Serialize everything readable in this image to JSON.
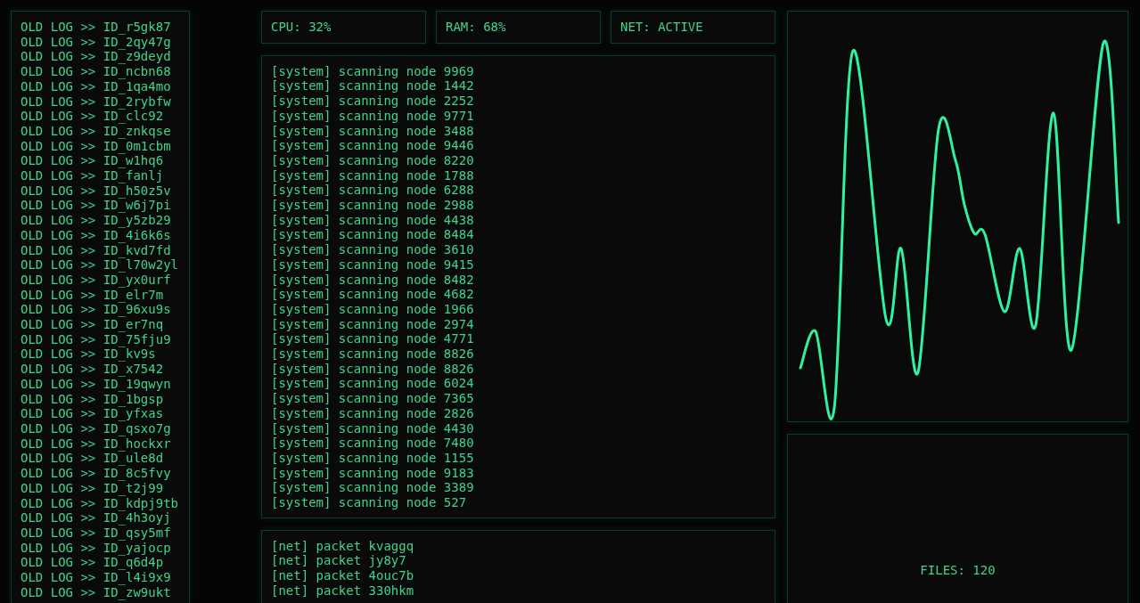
{
  "old_log": {
    "lines": [
      "OLD LOG >> ID_r5gk87",
      "OLD LOG >> ID_2qy47g",
      "OLD LOG >> ID_z9deyd",
      "OLD LOG >> ID_ncbn68",
      "OLD LOG >> ID_1qa4mo",
      "OLD LOG >> ID_2rybfw",
      "OLD LOG >> ID_clc92",
      "OLD LOG >> ID_znkqse",
      "OLD LOG >> ID_0m1cbm",
      "OLD LOG >> ID_w1hq6",
      "OLD LOG >> ID_fanlj",
      "OLD LOG >> ID_h50z5v",
      "OLD LOG >> ID_w6j7pi",
      "OLD LOG >> ID_y5zb29",
      "OLD LOG >> ID_4i6k6s",
      "OLD LOG >> ID_kvd7fd",
      "OLD LOG >> ID_l70w2yl",
      "OLD LOG >> ID_yx0urf",
      "OLD LOG >> ID_elr7m",
      "OLD LOG >> ID_96xu9s",
      "OLD LOG >> ID_er7nq",
      "OLD LOG >> ID_75fju9",
      "OLD LOG >> ID_kv9s",
      "OLD LOG >> ID_x7542",
      "OLD LOG >> ID_19qwyn",
      "OLD LOG >> ID_1bgsp",
      "OLD LOG >> ID_yfxas",
      "OLD LOG >> ID_qsxo7g",
      "OLD LOG >> ID_hockxr",
      "OLD LOG >> ID_ule8d",
      "OLD LOG >> ID_8c5fvy",
      "OLD LOG >> ID_t2j99",
      "OLD LOG >> ID_kdpj9tb",
      "OLD LOG >> ID_4h3oyj",
      "OLD LOG >> ID_qsy5mf",
      "OLD LOG >> ID_yajocp",
      "OLD LOG >> ID_q6d4p",
      "OLD LOG >> ID_l4i9x9",
      "OLD LOG >> ID_zw9ukt"
    ]
  },
  "stats": [
    "CPU: 32%",
    "RAM: 68%",
    "NET: ACTIVE"
  ],
  "system_log": {
    "lines": [
      "[system] scanning node 9969",
      "[system] scanning node 1442",
      "[system] scanning node 2252",
      "[system] scanning node 9771",
      "[system] scanning node 3488",
      "[system] scanning node 9446",
      "[system] scanning node 8220",
      "[system] scanning node 1788",
      "[system] scanning node 6288",
      "[system] scanning node 2988",
      "[system] scanning node 4438",
      "[system] scanning node 8484",
      "[system] scanning node 3610",
      "[system] scanning node 9415",
      "[system] scanning node 8482",
      "[system] scanning node 4682",
      "[system] scanning node 1966",
      "[system] scanning node 2974",
      "[system] scanning node 4771",
      "[system] scanning node 8826",
      "[system] scanning node 8826",
      "[system] scanning node 6024",
      "[system] scanning node 7365",
      "[system] scanning node 2826",
      "[system] scanning node 4430",
      "[system] scanning node 7480",
      "[system] scanning node 1155",
      "[system] scanning node 9183",
      "[system] scanning node 3389",
      "[system] scanning node 527"
    ]
  },
  "net_log": {
    "lines": [
      "[net] packet kvaggq",
      "[net] packet jy8y7",
      "[net] packet 4ouc7b",
      "[net] packet 330hkm"
    ]
  },
  "files_panel": {
    "label": "FILES: 120"
  }
}
